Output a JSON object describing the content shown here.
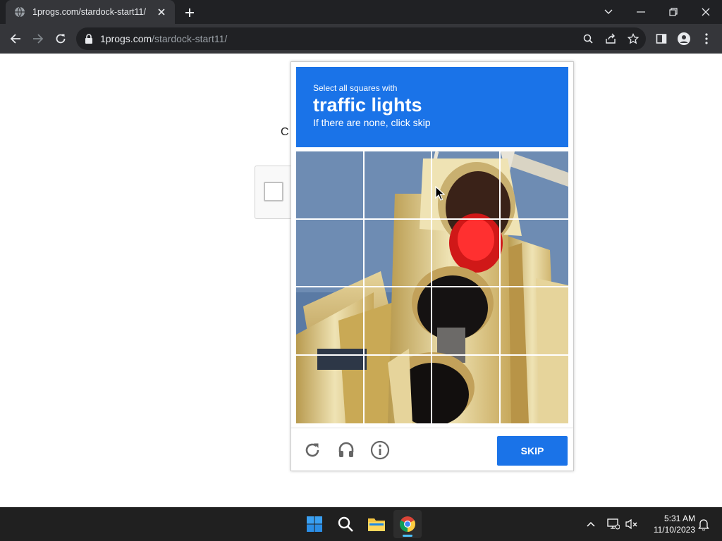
{
  "browser": {
    "tab_title": "1progs.com/stardock-start11/",
    "url_host": "1progs.com",
    "url_path": "/stardock-start11/"
  },
  "page": {
    "partial_text": "C"
  },
  "captcha": {
    "instruction_line1": "Select all squares with",
    "target": "traffic lights",
    "instruction_line3": "If there are none, click skip",
    "skip_label": "SKIP",
    "grid_rows": 4,
    "grid_cols": 4,
    "header_color": "#1a73e8"
  },
  "taskbar": {
    "time": "5:31 AM",
    "date": "11/10/2023"
  }
}
